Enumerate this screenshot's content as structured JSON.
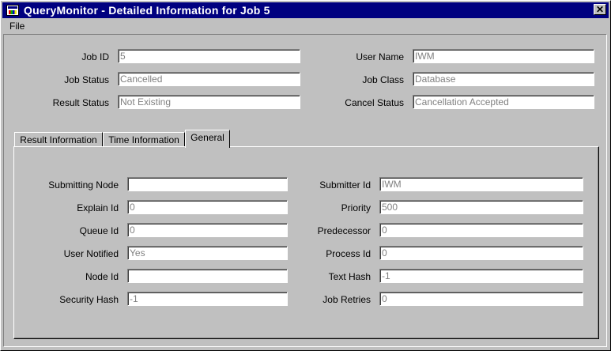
{
  "window": {
    "title": "QueryMonitor - Detailed Information for Job 5"
  },
  "menu": {
    "file": "File"
  },
  "job": {
    "job_id_label": "Job ID",
    "job_id": "5",
    "user_name_label": "User Name",
    "user_name": "IWM",
    "job_status_label": "Job Status",
    "job_status": "Cancelled",
    "job_class_label": "Job Class",
    "job_class": "Database",
    "result_status_label": "Result Status",
    "result_status": "Not Existing",
    "cancel_status_label": "Cancel Status",
    "cancel_status": "Cancellation Accepted"
  },
  "tabs": [
    "Result Information",
    "Time Information",
    "General"
  ],
  "active_tab": "General",
  "general": {
    "submitting_node_label": "Submitting Node",
    "submitting_node": "",
    "submitter_id_label": "Submitter Id",
    "submitter_id": "IWM",
    "explain_id_label": "Explain Id",
    "explain_id": "0",
    "priority_label": "Priority",
    "priority": "500",
    "queue_id_label": "Queue Id",
    "queue_id": "0",
    "predecessor_label": "Predecessor",
    "predecessor": "0",
    "user_notified_label": "User Notified",
    "user_notified": "Yes",
    "process_id_label": "Process Id",
    "process_id": "0",
    "node_id_label": "Node Id",
    "node_id": "",
    "text_hash_label": "Text Hash",
    "text_hash": "-1",
    "security_hash_label": "Security Hash",
    "security_hash": "-1",
    "job_retries_label": "Job Retries",
    "job_retries": "0"
  },
  "colors": {
    "titlebar": "#000080",
    "face": "#c0c0c0",
    "field_text": "#808080"
  },
  "icons": {
    "app": "querymonitor-app-icon",
    "close": "close-icon"
  }
}
